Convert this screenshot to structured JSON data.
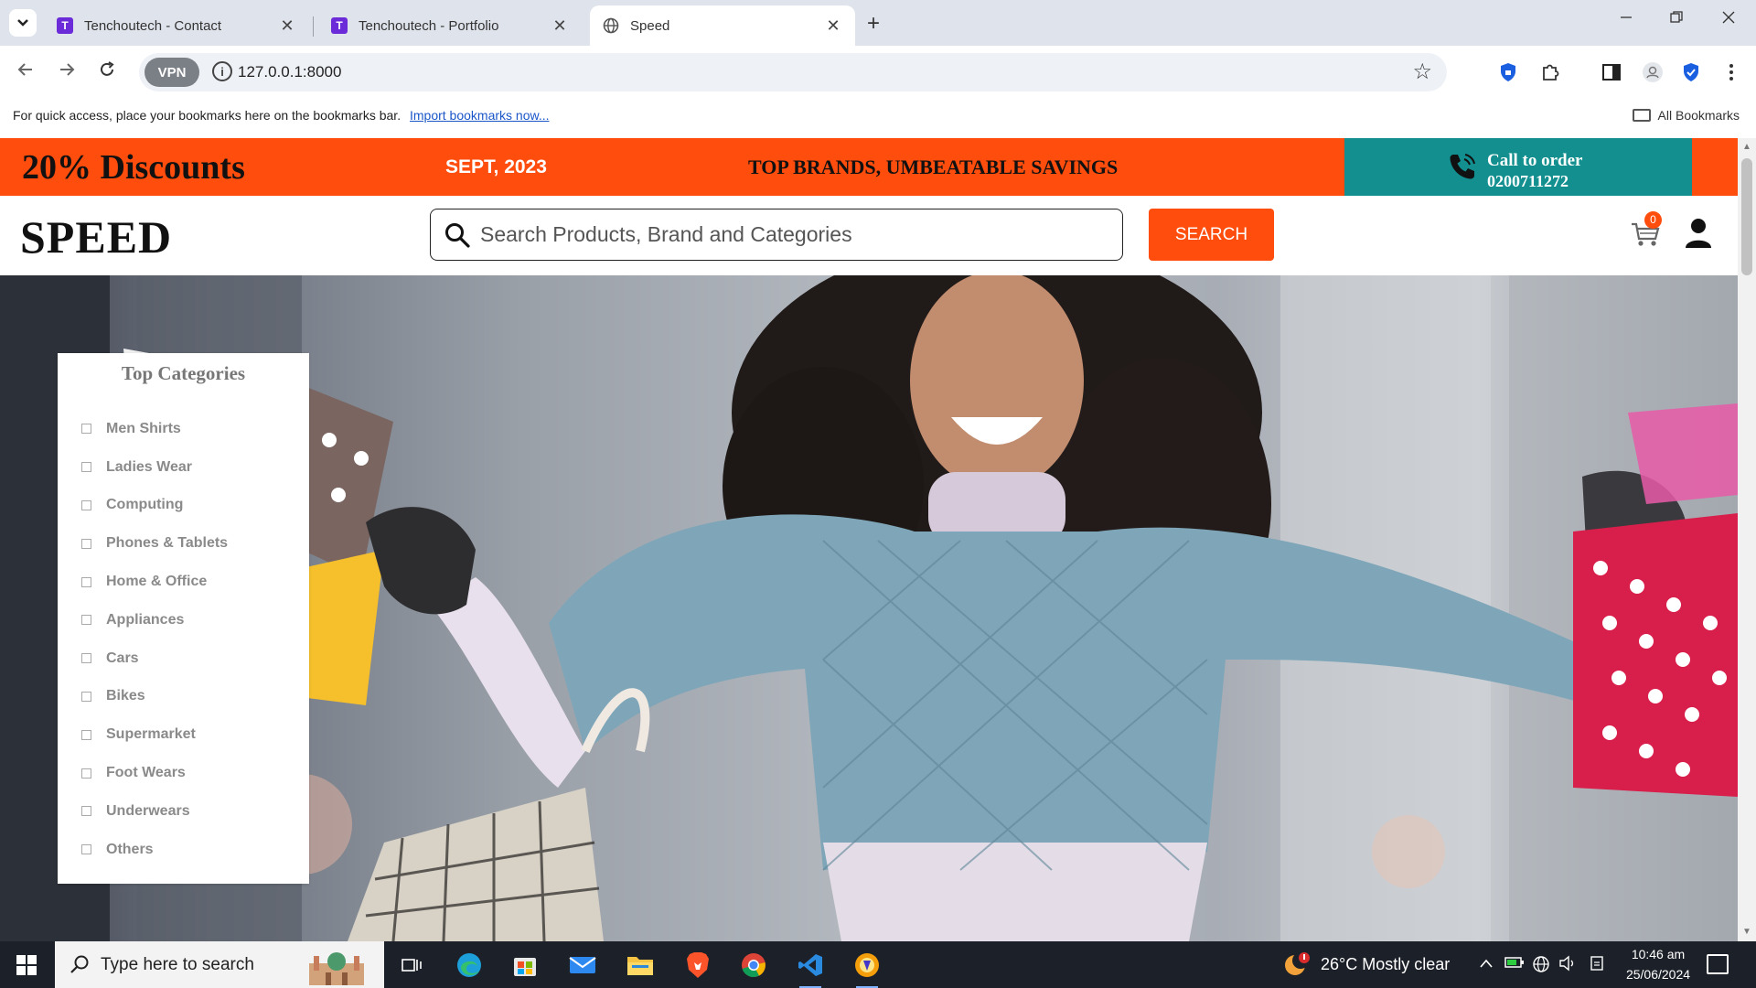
{
  "browser": {
    "tabs": [
      {
        "title": "Tenchoutech - Contact",
        "favicon": "T"
      },
      {
        "title": "Tenchoutech - Portfolio",
        "favicon": "T"
      },
      {
        "title": "Speed",
        "favicon": "globe-icon",
        "active": true
      }
    ],
    "tab_close": "✕",
    "new_tab": "+",
    "url": "127.0.0.1:8000",
    "vpn_label": "VPN",
    "bookmarks_bar_text": "For quick access, place your bookmarks here on the bookmarks bar.",
    "bookmarks_import_link": "Import bookmarks now...",
    "all_bookmarks": "All Bookmarks"
  },
  "promo": {
    "discount": "20% Discounts",
    "date": "SEPT, 2023",
    "slogan": "TOP BRANDS, UMBEATABLE SAVINGS",
    "call_label": "Call to order",
    "call_number": "0200711272"
  },
  "header": {
    "logo": "SPEED",
    "search_placeholder": "Search Products, Brand and Categories",
    "search_button": "SEARCH",
    "cart_count": "0"
  },
  "categories": {
    "title": "Top Categories",
    "items": [
      "Men Shirts",
      "Ladies Wear",
      "Computing",
      "Phones & Tablets",
      "Home & Office",
      "Appliances",
      "Cars",
      "Bikes",
      "Supermarket",
      "Foot Wears",
      "Underwears",
      "Others"
    ]
  },
  "slider": {
    "dot_count": 6,
    "active_index": 5
  },
  "taskbar": {
    "search_text": "Type here to search",
    "weather": "26°C  Mostly clear",
    "time": "10:46 am",
    "date": "25/06/2024"
  },
  "colors": {
    "accent": "#ff4d0d",
    "call_box": "#138f8f",
    "active_dot": "#1f8fd6"
  }
}
